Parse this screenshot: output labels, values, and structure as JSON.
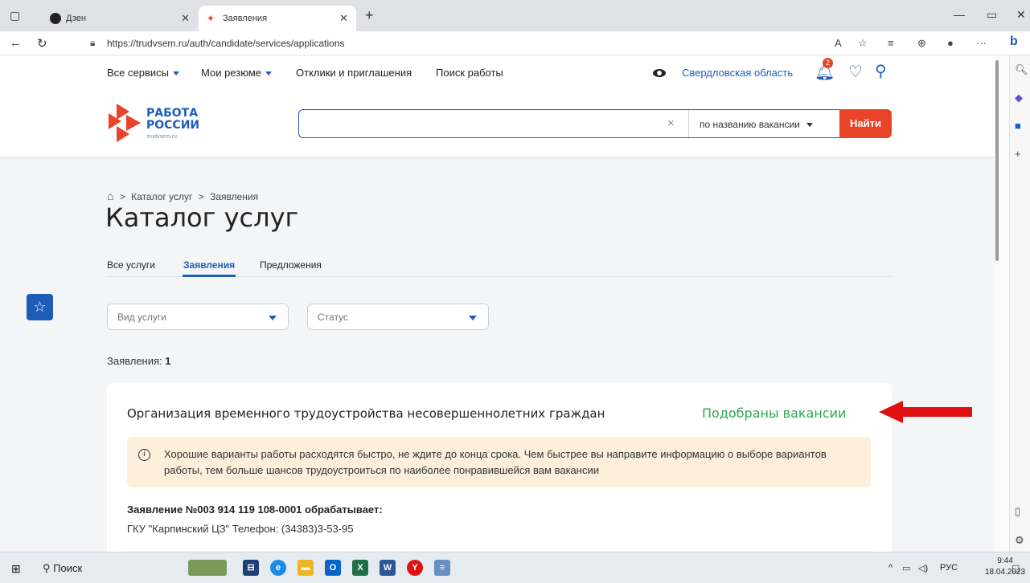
{
  "browser": {
    "tabs": [
      {
        "label": "Дзен",
        "active": false
      },
      {
        "label": "Заявления",
        "active": true
      }
    ],
    "url": "https://trudvsem.ru/auth/candidate/services/applications"
  },
  "site": {
    "topnav": [
      "Все сервисы",
      "Мои резюме",
      "Отклики и приглашения",
      "Поиск работы"
    ],
    "region": "Свердловская область",
    "notifications_count": "2",
    "logo": {
      "line1": "РАБОТА",
      "line2": "РОССИИ",
      "sub": "trudvsem.ru"
    },
    "search": {
      "value": "",
      "mode": "по названию вакансии",
      "button": "Найти",
      "clear": "×"
    }
  },
  "breadcrumb": {
    "home": "⌂",
    "sep1": ">",
    "item1": "Каталог услуг",
    "sep2": ">",
    "item2": "Заявления"
  },
  "page_title": "Каталог услуг",
  "tabs": [
    "Все услуги",
    "Заявления",
    "Предложения"
  ],
  "filters": {
    "service_type": "Вид услуги",
    "status": "Статус"
  },
  "count": {
    "label": "Заявления:",
    "value": "1"
  },
  "application": {
    "title": "Организация временного трудоустройства несовершеннолетних граждан",
    "status": "Подобраны вакансии",
    "notice": "Хорошие варианты работы расходятся быстро, не ждите до конца срока. Чем быстрее вы направите информацию о выборе вариантов работы, тем больше шансов трудоустроиться по наиболее понравившейся вам вакансии",
    "number": "Заявление №003 914 119 108-0001 обрабатывает:",
    "org": "ГКУ \"Карпинский ЦЗ\" Телефон: (34383)3-53-95"
  },
  "taskbar": {
    "search": "Поиск",
    "lang": "РУС",
    "time": "9:44",
    "date": "18.04.2023"
  },
  "colors": {
    "brand_blue": "#1d5db8",
    "accent_red": "#e8442a",
    "status_green": "#2fa84f",
    "notice_bg": "#fdefdc"
  }
}
